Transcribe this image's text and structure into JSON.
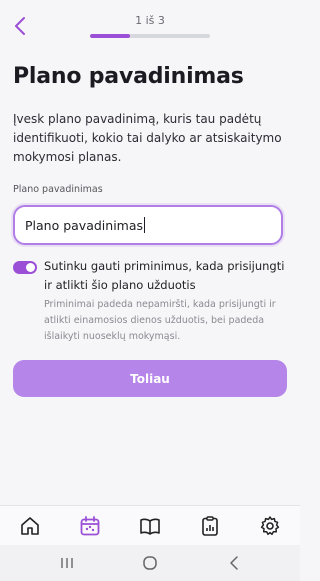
{
  "header": {
    "back_icon": "chevron-left-icon",
    "step_text": "1 iš 3",
    "progress_fraction": 0.333
  },
  "title": "Plano pavadinimas",
  "description": "Įvesk plano pavadinimą, kuris tau padėtų identifikuoti, kokio tai dalyko ar atsiskaitymo mokymosi planas.",
  "field": {
    "label": "Plano pavadinimas",
    "value": "Plano pavadinimas"
  },
  "reminder": {
    "enabled": true,
    "label": "Sutinku gauti priminimus, kada prisijungti ir atlikti šio plano užduotis",
    "hint": "Priminimai padeda nepamiršti, kada prisijungti ir atlikti einamosios dienos užduotis, bei padeda išlaikyti nuoseklų mokymąsi."
  },
  "primary_button": {
    "label": "Toliau"
  },
  "bottom_nav": {
    "items": [
      {
        "icon": "home-icon",
        "active": false
      },
      {
        "icon": "calendar-icon",
        "active": true
      },
      {
        "icon": "book-icon",
        "active": false
      },
      {
        "icon": "report-icon",
        "active": false
      },
      {
        "icon": "gear-icon",
        "active": false
      }
    ]
  },
  "system_nav": {
    "items": [
      "recents-icon",
      "home-circle-icon",
      "back-chevron-icon"
    ]
  },
  "colors": {
    "accent": "#9b4fd6",
    "button": "#b585ea",
    "background": "#f6f6f8"
  }
}
